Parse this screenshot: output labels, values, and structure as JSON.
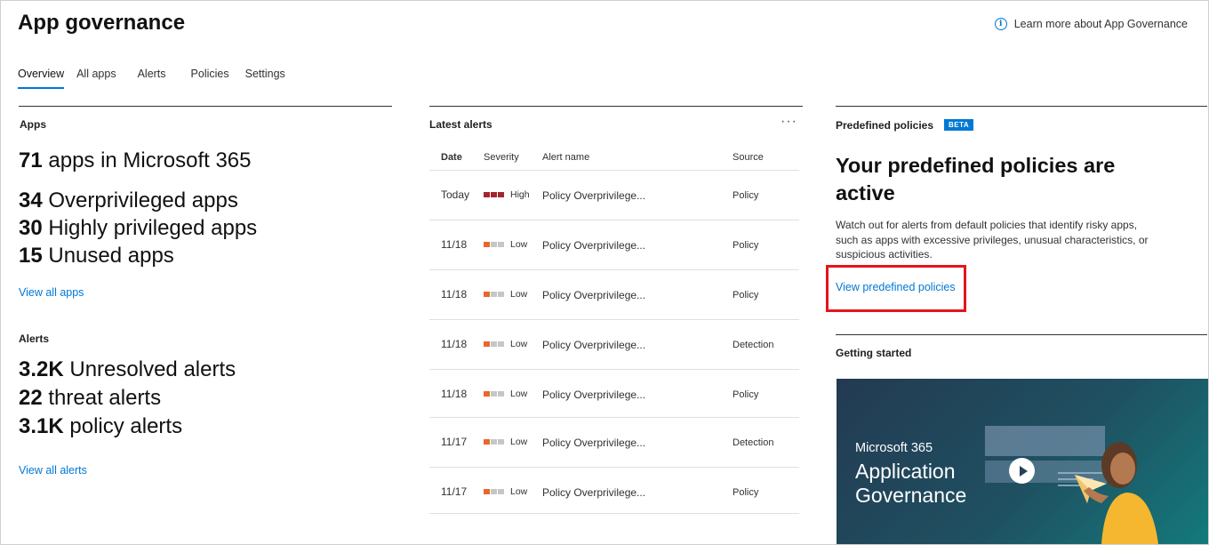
{
  "header": {
    "title": "App governance",
    "learn_more": "Learn more about App Governance"
  },
  "tabs": [
    {
      "label": "Overview",
      "active": true
    },
    {
      "label": "All apps"
    },
    {
      "label": "Alerts"
    },
    {
      "label": "Policies"
    },
    {
      "label": "Settings"
    }
  ],
  "apps": {
    "section_label": "Apps",
    "total_num": "71",
    "total_text": "apps in Microsoft 365",
    "overprivileged_num": "34",
    "overprivileged_text": "Overprivileged apps",
    "highly_num": "30",
    "highly_text": "Highly privileged apps",
    "unused_num": "15",
    "unused_text": "Unused apps",
    "view_link": "View all apps"
  },
  "alerts_summary": {
    "section_label": "Alerts",
    "unresolved_num": "3.2K",
    "unresolved_text": "Unresolved alerts",
    "threat_num": "22",
    "threat_text": "threat alerts",
    "policy_num": "3.1K",
    "policy_text": "policy alerts",
    "view_link": "View all alerts"
  },
  "latest_alerts": {
    "section_label": "Latest alerts",
    "more_label": "···",
    "columns": [
      "Date",
      "Severity",
      "Alert name",
      "Source"
    ],
    "rows": [
      {
        "date": "Today",
        "severity": "High",
        "name": "Policy Overprivilege...",
        "source": "Policy"
      },
      {
        "date": "11/18",
        "severity": "Low",
        "name": "Policy Overprivilege...",
        "source": "Policy"
      },
      {
        "date": "11/18",
        "severity": "Low",
        "name": "Policy Overprivilege...",
        "source": "Policy"
      },
      {
        "date": "11/18",
        "severity": "Low",
        "name": "Policy Overprivilege...",
        "source": "Detection"
      },
      {
        "date": "11/18",
        "severity": "Low",
        "name": "Policy Overprivilege...",
        "source": "Policy"
      },
      {
        "date": "11/17",
        "severity": "Low",
        "name": "Policy Overprivilege...",
        "source": "Detection"
      },
      {
        "date": "11/17",
        "severity": "Low",
        "name": "Policy Overprivilege...",
        "source": "Policy"
      }
    ],
    "severity_colors": {
      "high": "#a4262c",
      "low": "#e8672c",
      "empty": "#c8c6c4"
    }
  },
  "predefined": {
    "section_label": "Predefined policies",
    "badge": "BETA",
    "heading": "Your predefined policies are active",
    "description": "Watch out for alerts from default policies that identify risky apps, such as apps with excessive privileges, unusual characteristics, or suspicious activities.",
    "view_link": "View predefined policies"
  },
  "getting_started": {
    "section_label": "Getting started",
    "video_line1": "Microsoft 365",
    "video_line2": "Application",
    "video_line3": "Governance"
  },
  "colors": {
    "accent": "#0078d4",
    "highlight_box": "#e3141f"
  }
}
